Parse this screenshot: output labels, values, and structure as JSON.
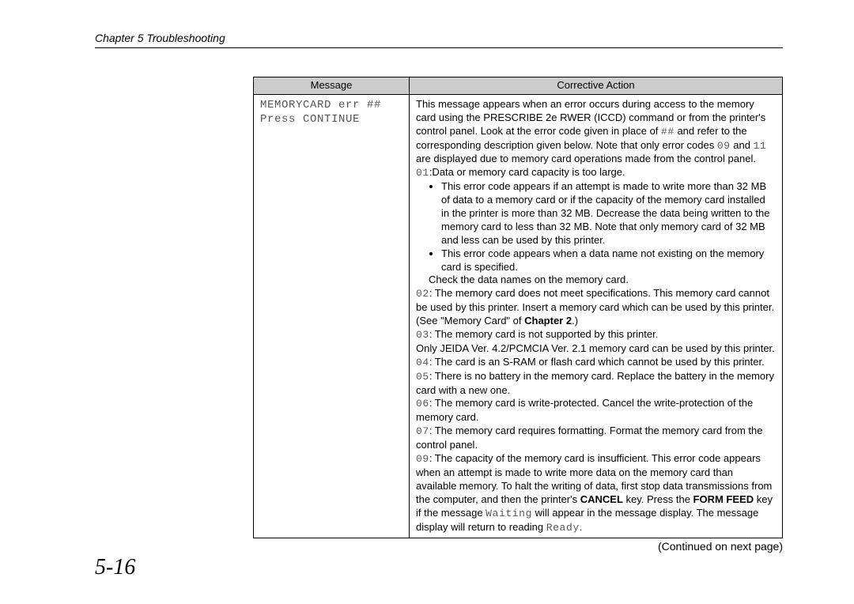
{
  "header": "Chapter 5  Troubleshooting",
  "table": {
    "col_message": "Message",
    "col_action": "Corrective Action",
    "msg_line1": "MEMORYCARD err ##",
    "msg_line2": "Press CONTINUE"
  },
  "action": {
    "intro1": "This message appears when an error occurs during access to the memory card using the PRESCRIBE 2e RWER (ICCD) command or from the printer's control panel. Look at the error code given in place of ",
    "intro_hash": "##",
    "intro2": " and refer to the corresponding description given below. Note that only error codes ",
    "code09": "09",
    "intro3": " and ",
    "code11": "11",
    "intro4": " are displayed due to memory card operations made from the control panel.",
    "c01_label": "01",
    "c01_text": ":Data or memory card capacity is too large.",
    "b1": "This error code appears if an attempt is made to write more than 32 MB of data to a memory card or if the capacity of the memory card installed in the printer is more than 32 MB.  Decrease the data being written to the memory card to less than 32 MB.  Note that only memory card of 32 MB and less can be used by this printer.",
    "b2": "This error code appears when a data name not existing on the memory card is specified.",
    "b2_tail": "Check the data names on the memory card.",
    "c02_label": "02",
    "c02_text": ": The memory card does not meet specifications.  This memory card cannot be used by this printer.  Insert a memory card which can be used by this printer.  (See \"Memory Card\" of ",
    "chapter2": "Chapter 2",
    "c02_tail": ".)",
    "c03_label": "03",
    "c03_text": ": The memory card is not supported by this printer.",
    "c03_tail": "Only JEIDA Ver. 4.2/PCMCIA Ver. 2.1 memory card can be used by this printer.",
    "c04_label": "04",
    "c04_text": ": The card is an S-RAM or flash card which cannot be used by this printer.",
    "c05_label": "05",
    "c05_text": ": There is no battery in the memory card.  Replace the battery in the memory card with a new one.",
    "c06_label": "06",
    "c06_text": ": The memory card is write-protected.  Cancel the write-protection of the memory card.",
    "c07_label": "07",
    "c07_text": ": The memory card requires formatting.  Format the memory card from the control panel.",
    "c09_pre": ": The capacity of the memory card is insufficient.  This error code appears when an attempt is made to write more data on the memory card than available memory.  To halt the writing of data, first stop data transmissions from the computer, and then the printer's ",
    "cancel": "CANCEL",
    "c09_mid": " key.  Press the ",
    "formfeed": "FORM FEED",
    "c09_mid2": " key if the message ",
    "waiting": "Waiting",
    "c09_mid3": " will appear in the message display.  The message display will return to reading ",
    "ready": "Ready",
    "c09_tail": "."
  },
  "continued": "(Continued on next page)",
  "page_number": "5-16"
}
